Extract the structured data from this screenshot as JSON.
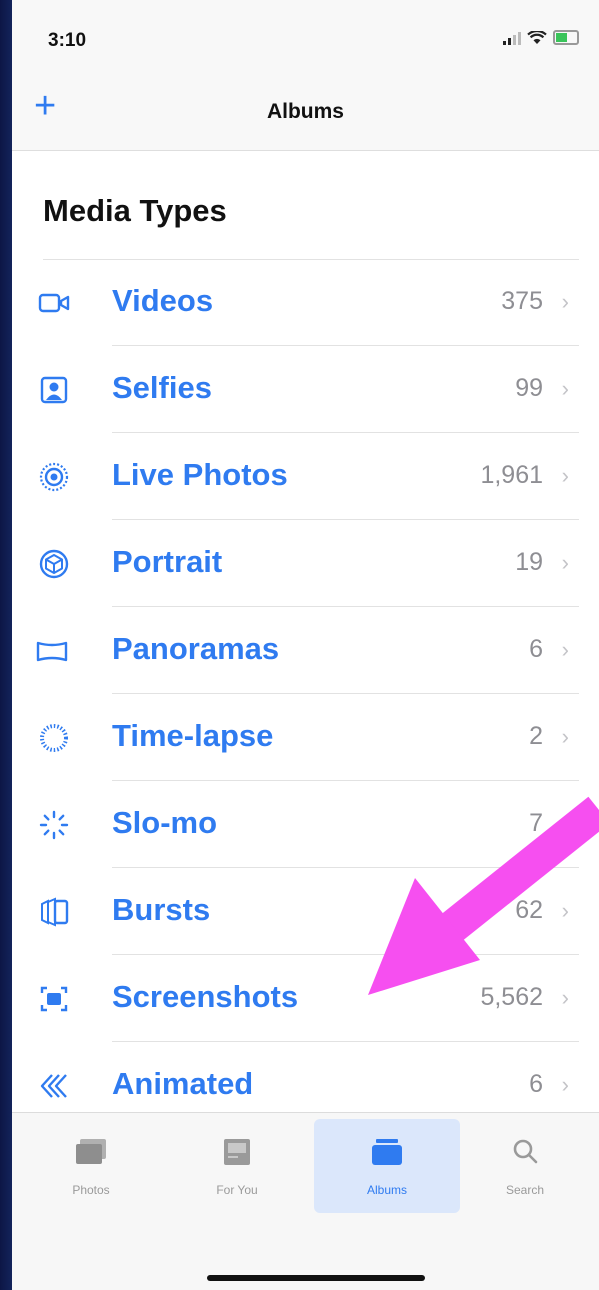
{
  "status": {
    "time": "3:10"
  },
  "nav": {
    "add_label": "+",
    "title": "Albums"
  },
  "section": {
    "title": "Media Types"
  },
  "rows": [
    {
      "label": "Videos",
      "count": "375",
      "icon": "video-icon"
    },
    {
      "label": "Selfies",
      "count": "99",
      "icon": "selfie-icon"
    },
    {
      "label": "Live Photos",
      "count": "1,961",
      "icon": "live-photo-icon"
    },
    {
      "label": "Portrait",
      "count": "19",
      "icon": "portrait-icon"
    },
    {
      "label": "Panoramas",
      "count": "6",
      "icon": "panorama-icon"
    },
    {
      "label": "Time-lapse",
      "count": "2",
      "icon": "timelapse-icon"
    },
    {
      "label": "Slo-mo",
      "count": "7",
      "icon": "slomo-icon"
    },
    {
      "label": "Bursts",
      "count": "62",
      "icon": "bursts-icon"
    },
    {
      "label": "Screenshots",
      "count": "5,562",
      "icon": "screenshot-icon"
    },
    {
      "label": "Animated",
      "count": "6",
      "icon": "animated-icon"
    }
  ],
  "chevron": "›",
  "tabs": [
    {
      "label": "Photos",
      "selected": false
    },
    {
      "label": "For You",
      "selected": false
    },
    {
      "label": "Albums",
      "selected": true
    },
    {
      "label": "Search",
      "selected": false
    }
  ],
  "colors": {
    "accent": "#2f7bf0",
    "arrow": "#f64ff0"
  }
}
